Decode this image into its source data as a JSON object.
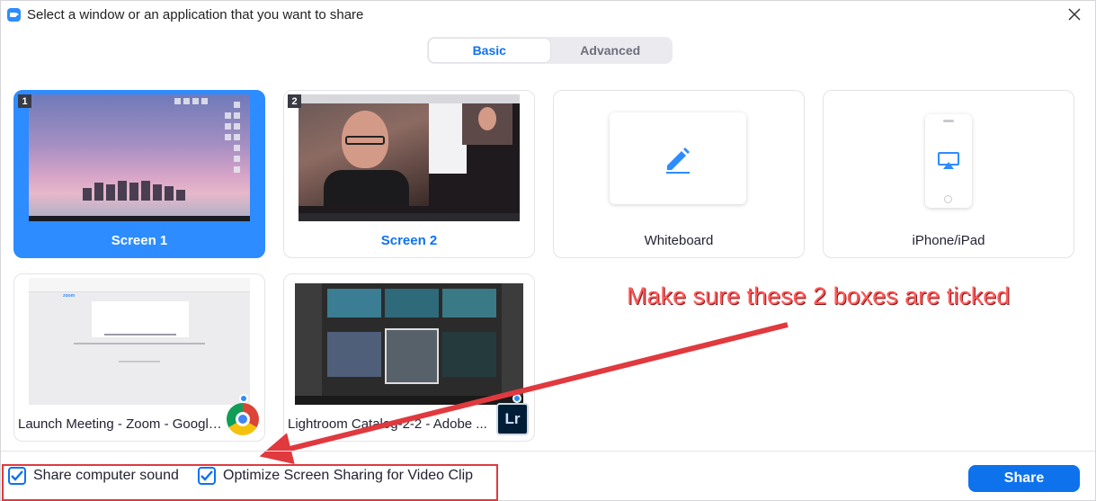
{
  "window": {
    "title": "Select a window or an application that you want to share"
  },
  "tabs": [
    {
      "label": "Basic",
      "active": true
    },
    {
      "label": "Advanced",
      "active": false
    }
  ],
  "cards": {
    "screen1": {
      "badge": "1",
      "label": "Screen 1",
      "selected": true
    },
    "screen2": {
      "badge": "2",
      "label": "Screen 2",
      "selected": false
    },
    "whiteboard": {
      "label": "Whiteboard",
      "icon": "pencil-icon"
    },
    "iphone": {
      "label": "iPhone/iPad",
      "icon": "airplay-icon"
    },
    "launch_meeting": {
      "label": "Launch Meeting - Zoom - Google...",
      "icon": "chrome-icon",
      "thumb_brand": "zoom"
    },
    "lightroom": {
      "label": "Lightroom Catalog-2-2 - Adobe ...",
      "icon": "lightroom-icon",
      "icon_text": "Lr"
    }
  },
  "annotation": {
    "text": "Make sure these 2 boxes are ticked",
    "color": "#ff5b5b"
  },
  "options": {
    "share_sound": {
      "label": "Share computer sound",
      "checked": true
    },
    "optimize_video": {
      "label": "Optimize Screen Sharing for Video Clip",
      "checked": true
    }
  },
  "share_button": {
    "label": "Share"
  },
  "colors": {
    "accent": "#0e72ed",
    "selected": "#2D8CFF",
    "annotation_red": "#e0393e"
  }
}
